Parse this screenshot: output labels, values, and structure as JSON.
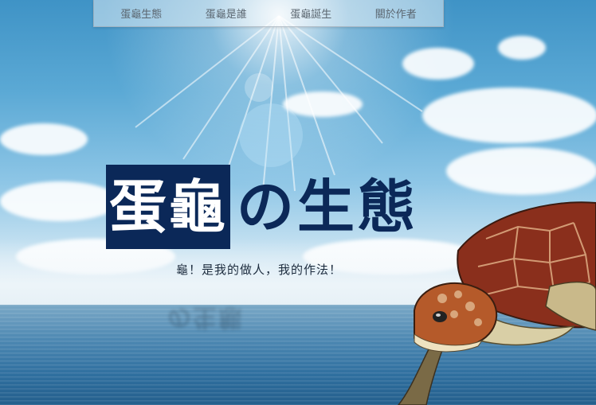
{
  "nav": {
    "items": [
      {
        "label": "蛋龜生態"
      },
      {
        "label": "蛋龜是誰"
      },
      {
        "label": "蛋龜誕生"
      },
      {
        "label": "關於作者"
      }
    ]
  },
  "hero": {
    "title_highlight": "蛋龜",
    "title_rest": "の生態",
    "subtitle": "龜！是我的做人，我的作法！"
  },
  "colors": {
    "title_navy": "#0b2858",
    "nav_text": "#5b6670",
    "sky_top": "#3f93c6",
    "sea": "#2f6f9f"
  },
  "icons": {
    "hero_image": "sea-turtle-image"
  }
}
